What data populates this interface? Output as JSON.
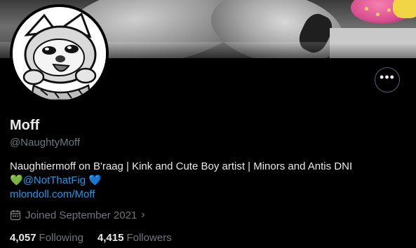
{
  "profile": {
    "display_name": "Moff",
    "handle": "@NaughtyMoff",
    "bio_line1": "Naughtiermoff on B'raag | Kink and Cute Boy artist | Minors and Antis DNI",
    "bio_heart_green": "💚",
    "bio_mention": "@NotThatFig",
    "bio_heart_blue": "💙",
    "website": "mlondoll.com/Moff",
    "joined": "Joined September 2021",
    "following_count": "4,057",
    "following_label": "Following",
    "followers_count": "4,415",
    "followers_label": "Followers"
  },
  "icons": {
    "more": "more-horizontal-icon",
    "calendar": "calendar-icon",
    "chevron": "chevron-right-icon"
  },
  "colors": {
    "background": "#000000",
    "primary_text": "#e7e9ea",
    "secondary_text": "#71767b",
    "link": "#1d9bf0",
    "border": "#536471"
  }
}
